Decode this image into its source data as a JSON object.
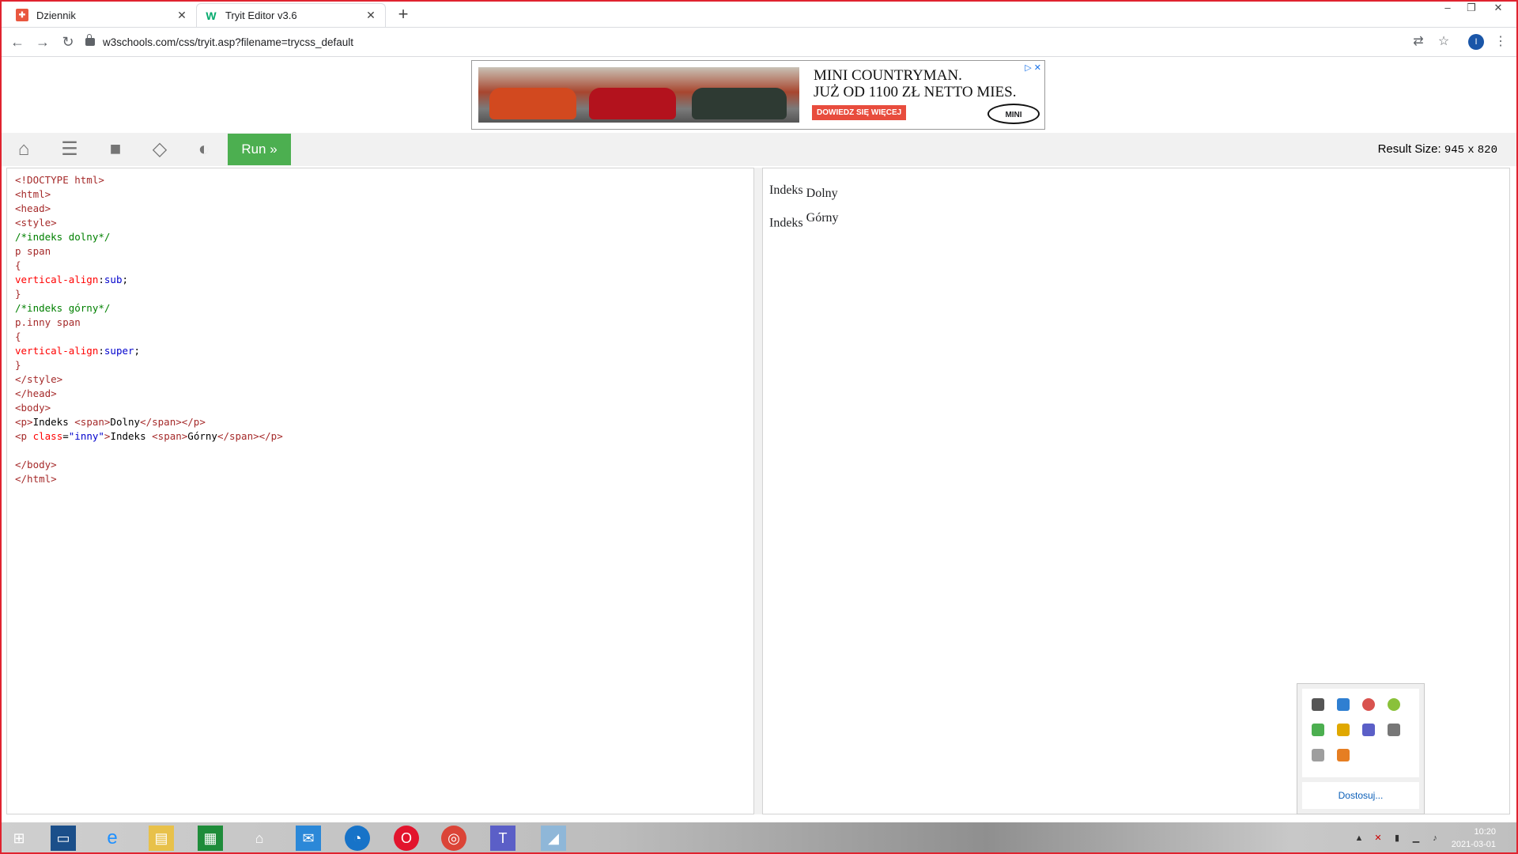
{
  "browser": {
    "tabs": [
      {
        "title": "Dziennik",
        "favicon": "grid-favicon"
      },
      {
        "title": "Tryit Editor v3.6",
        "favicon": "w3schools-favicon"
      }
    ],
    "new_tab": "+",
    "url": "w3schools.com/css/tryit.asp?filename=trycss_default"
  },
  "ad": {
    "headline_line1": "MINI COUNTRYMAN.",
    "headline_line2": "JUŻ OD 1100 ZŁ NETTO MIES.",
    "cta": "DOWIEDZ SIĘ WIĘCEJ",
    "logo": "MINI"
  },
  "toolbar": {
    "run_label": "Run »",
    "result_label": "Result Size:",
    "result_width": "945",
    "result_x": "x",
    "result_height": "820"
  },
  "result": {
    "p1_text": "Indeks",
    "p1_span": "Dolny",
    "p2_text": "Indeks",
    "p2_span": "Górny"
  },
  "tray": {
    "customize_link": "Dostosuj..."
  },
  "clock": {
    "time": "10:20",
    "date": "2021-03-01"
  },
  "colors": {
    "run_button": "#4caf50",
    "frame": "#e0232f"
  }
}
